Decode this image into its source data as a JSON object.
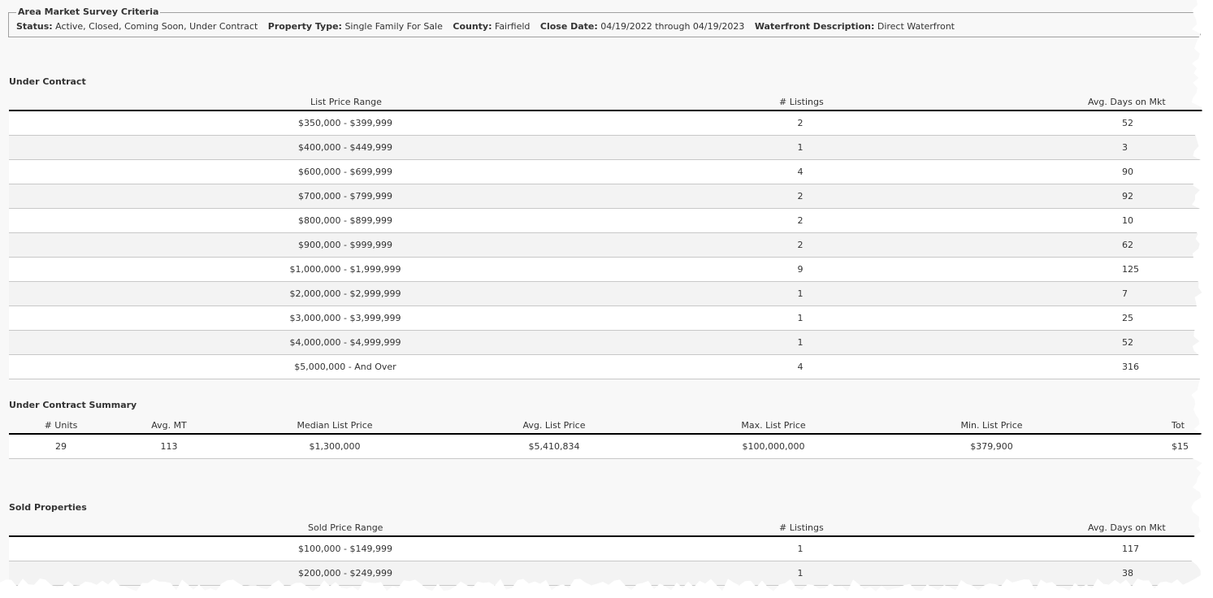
{
  "criteria": {
    "title": "Area Market Survey Criteria",
    "status_label": "Status:",
    "status_value": "Active, Closed, Coming Soon, Under Contract",
    "ptype_label": "Property Type:",
    "ptype_value": "Single Family For Sale",
    "county_label": "County:",
    "county_value": "Fairfield",
    "close_label": "Close Date:",
    "close_value": "04/19/2022 through 04/19/2023",
    "water_label": "Waterfront Description:",
    "water_value": "Direct Waterfront"
  },
  "under_contract": {
    "title": "Under Contract",
    "headers": [
      "List Price Range",
      "# Listings",
      "Avg. Days on Mkt"
    ],
    "rows": [
      [
        "$350,000 - $399,999",
        "2",
        "52"
      ],
      [
        "$400,000 - $449,999",
        "1",
        "3"
      ],
      [
        "$600,000 - $699,999",
        "4",
        "90"
      ],
      [
        "$700,000 - $799,999",
        "2",
        "92"
      ],
      [
        "$800,000 - $899,999",
        "2",
        "10"
      ],
      [
        "$900,000 - $999,999",
        "2",
        "62"
      ],
      [
        "$1,000,000 - $1,999,999",
        "9",
        "125"
      ],
      [
        "$2,000,000 - $2,999,999",
        "1",
        "7"
      ],
      [
        "$3,000,000 - $3,999,999",
        "1",
        "25"
      ],
      [
        "$4,000,000 - $4,999,999",
        "1",
        "52"
      ],
      [
        "$5,000,000 - And Over",
        "4",
        "316"
      ]
    ]
  },
  "uc_summary": {
    "title": "Under Contract Summary",
    "headers": [
      "# Units",
      "Avg. MT",
      "Median List Price",
      "Avg. List Price",
      "Max. List Price",
      "Min. List Price",
      "Tot"
    ],
    "values": [
      "29",
      "113",
      "$1,300,000",
      "$5,410,834",
      "$100,000,000",
      "$379,900",
      "$15"
    ]
  },
  "sold": {
    "title": "Sold Properties",
    "headers": [
      "Sold Price Range",
      "# Listings",
      "Avg. Days on Mkt"
    ],
    "rows": [
      [
        "$100,000 - $149,999",
        "1",
        "117"
      ],
      [
        "$200,000 - $249,999",
        "1",
        "38"
      ]
    ]
  }
}
